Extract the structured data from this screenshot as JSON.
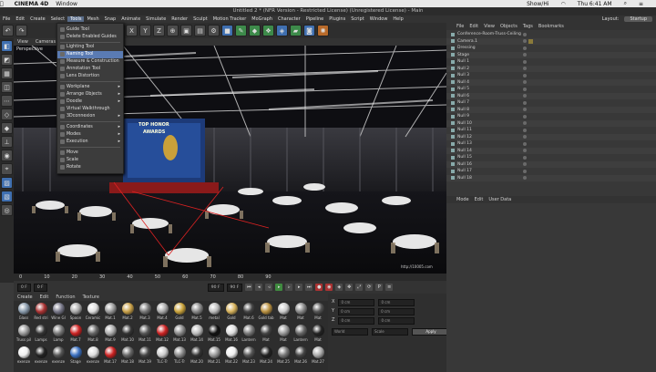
{
  "mac": {
    "app": "CINEMA 4D",
    "menu": [
      "Window"
    ],
    "tray": "Show/Hi",
    "clock": "Thu 6:41 AM"
  },
  "window_title": "Untitled 2 * (NFR Version - Restricted License) (Unregistered License) - Main",
  "menubar": {
    "items": [
      "File",
      "Edit",
      "Create",
      "Select",
      "Tools",
      "Mesh",
      "Snap",
      "Animate",
      "Simulate",
      "Render",
      "Sculpt",
      "Motion Tracker",
      "MoGraph",
      "Character",
      "Pipeline",
      "Plugins",
      "Script",
      "Window",
      "Help"
    ],
    "active": "Tools",
    "layout_label": "Layout:",
    "layout_value": "Startup"
  },
  "viewport": {
    "menu": [
      "View",
      "Cameras"
    ],
    "label": "Perspective",
    "banner": [
      "TOP HONOR",
      "AWARDS"
    ],
    "watermark": "http://10005.com"
  },
  "tools_menu": [
    {
      "label": "Guide Tool",
      "arrow": false
    },
    {
      "label": "Delete Enabled Guides",
      "arrow": false
    },
    {
      "label": "",
      "sep": true
    },
    {
      "label": "Lighting Tool",
      "arrow": false
    },
    {
      "label": "Naming Tool",
      "arrow": false,
      "hl": true
    },
    {
      "label": "Measure & Construction",
      "arrow": false
    },
    {
      "label": "Annotation Tool",
      "arrow": false
    },
    {
      "label": "Lens Distortion",
      "arrow": false
    },
    {
      "label": "",
      "sep": true
    },
    {
      "label": "Workplane",
      "arrow": true
    },
    {
      "label": "Arrange Objects",
      "arrow": true
    },
    {
      "label": "Doodle",
      "arrow": true
    },
    {
      "label": "Virtual Walkthrough",
      "arrow": false
    },
    {
      "label": "3Dconnexion",
      "arrow": true
    },
    {
      "label": "",
      "sep": true
    },
    {
      "label": "Coordinates",
      "arrow": true
    },
    {
      "label": "Modes",
      "arrow": true
    },
    {
      "label": "Execution",
      "arrow": true
    },
    {
      "label": "",
      "sep": true
    },
    {
      "label": "Move",
      "arrow": false
    },
    {
      "label": "Scale",
      "arrow": false
    },
    {
      "label": "Rotate",
      "arrow": false
    }
  ],
  "objects": {
    "menu": [
      "File",
      "Edit",
      "View",
      "Objects",
      "Tags",
      "Bookmarks"
    ],
    "rows": [
      "Conference-Room-Truss-Ceiling",
      "Camera.1",
      "Dressing",
      "Stage",
      "Null 1",
      "Null 2",
      "Null 3",
      "Null 4",
      "Null 5",
      "Null 6",
      "Null 7",
      "Null 8",
      "Null 9",
      "Null 10",
      "Null 11",
      "Null 12",
      "Null 13",
      "Null 14",
      "Null 15",
      "Null 16",
      "Null 17",
      "Null 18"
    ]
  },
  "attributes": {
    "menu": [
      "Mode",
      "Edit",
      "User Data"
    ]
  },
  "timeline": {
    "ticks": [
      "0",
      "10",
      "20",
      "30",
      "40",
      "50",
      "60",
      "70",
      "80",
      "90"
    ],
    "frame": "0 F",
    "end": "90 F"
  },
  "materials": {
    "menu": [
      "Create",
      "Edit",
      "Function",
      "Texture"
    ],
    "items": [
      {
        "name": "Glass",
        "color": "#8899aa"
      },
      {
        "name": "Red stri",
        "color": "#a33"
      },
      {
        "name": "Wine Gl",
        "color": "#778"
      },
      {
        "name": "Spoon",
        "color": "#aaa"
      },
      {
        "name": "Ceramic",
        "color": "#ddd"
      },
      {
        "name": "Mat.1",
        "color": "#999"
      },
      {
        "name": "Mat.2",
        "color": "#c8a048"
      },
      {
        "name": "Mat.3",
        "color": "#777"
      },
      {
        "name": "Mat.4",
        "color": "#aaa"
      },
      {
        "name": "Gold",
        "color": "#c9a23a"
      },
      {
        "name": "Mat.5",
        "color": "#888"
      },
      {
        "name": "metal",
        "color": "#bbb"
      },
      {
        "name": "Gold",
        "color": "#d4b05a"
      },
      {
        "name": "Mat.6",
        "color": "#444"
      },
      {
        "name": "Gold tab",
        "color": "#b89040"
      },
      {
        "name": "Mat",
        "color": "#ccc"
      },
      {
        "name": "Mat",
        "color": "#888"
      },
      {
        "name": "Mat",
        "color": "#555"
      },
      {
        "name": "Truss pil",
        "color": "#999"
      },
      {
        "name": "Lamps",
        "color": "#333"
      },
      {
        "name": "Lamp",
        "color": "#777"
      },
      {
        "name": "Mat.7",
        "color": "#c22"
      },
      {
        "name": "Mat.8",
        "color": "#666"
      },
      {
        "name": "Mat.9",
        "color": "#aaa"
      },
      {
        "name": "Mat.10",
        "color": "#333"
      },
      {
        "name": "Mat.11",
        "color": "#555"
      },
      {
        "name": "Mat.12",
        "color": "#c22"
      },
      {
        "name": "Mat.13",
        "color": "#888"
      },
      {
        "name": "Mat.14",
        "color": "#bbb"
      },
      {
        "name": "Mat.15",
        "color": "#111"
      },
      {
        "name": "Mat.16",
        "color": "#ddd"
      },
      {
        "name": "Lantern",
        "color": "#777"
      },
      {
        "name": "Mat",
        "color": "#444"
      },
      {
        "name": "Mat",
        "color": "#999"
      },
      {
        "name": "Lantern",
        "color": "#666"
      },
      {
        "name": "Mat",
        "color": "#222"
      },
      {
        "name": "exenze",
        "color": "#eee"
      },
      {
        "name": "exenze",
        "color": "#222"
      },
      {
        "name": "exenze",
        "color": "#555"
      },
      {
        "name": "Stage",
        "color": "#3a6fc0"
      },
      {
        "name": "exenze",
        "color": "#ddd"
      },
      {
        "name": "Mat.17",
        "color": "#c22"
      },
      {
        "name": "Mat.18",
        "color": "#666"
      },
      {
        "name": "Mat.19",
        "color": "#444"
      },
      {
        "name": "TLC-Tr",
        "color": "#ccc"
      },
      {
        "name": "TLC-Tr",
        "color": "#888"
      },
      {
        "name": "Mat.20",
        "color": "#333"
      },
      {
        "name": "Mat.21",
        "color": "#999"
      },
      {
        "name": "Mat.22",
        "color": "#eee"
      },
      {
        "name": "Mat.23",
        "color": "#555"
      },
      {
        "name": "Mat.24",
        "color": "#222"
      },
      {
        "name": "Mat.25",
        "color": "#777"
      },
      {
        "name": "Mat.26",
        "color": "#444"
      },
      {
        "name": "Mat.27",
        "color": "#aaa"
      }
    ]
  },
  "coord": {
    "x": "X",
    "y": "Y",
    "z": "Z",
    "values": [
      "0 cm",
      "0 cm",
      "0 cm",
      "0 cm",
      "0 cm",
      "0 cm",
      "0 °",
      "0 °",
      "0 °"
    ],
    "world": "World",
    "scale": "Scale",
    "apply": "Apply"
  },
  "colors": {
    "accent": "#5a7bb3",
    "panel": "#383838"
  }
}
